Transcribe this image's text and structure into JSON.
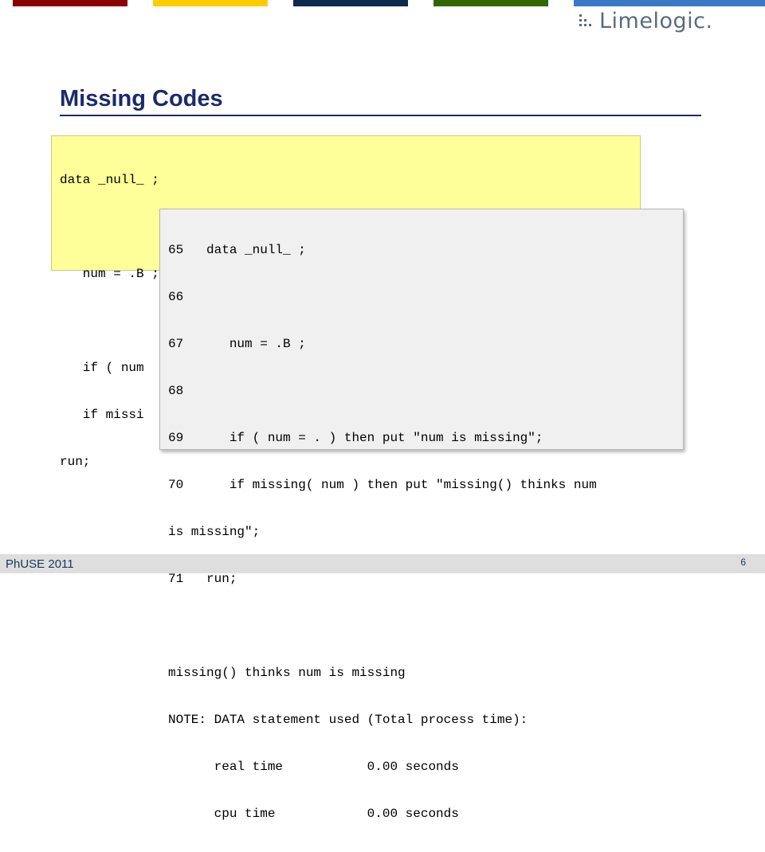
{
  "stripes": [
    {
      "name": "red",
      "color": "#8b0000"
    },
    {
      "name": "yellow",
      "color": "#ffcc00"
    },
    {
      "name": "navy",
      "color": "#0d2a4d"
    },
    {
      "name": "green",
      "color": "#336600"
    },
    {
      "name": "blue",
      "color": "#3a78c8"
    }
  ],
  "logo": {
    "text": "Limelogic.",
    "color": "#5a6b7c"
  },
  "title": "Missing Codes",
  "code_lines": [
    "data _null_ ;",
    "",
    "   num = .B ;",
    "",
    "   if ( num",
    "   if missi",
    "run;"
  ],
  "log_lines": [
    "65   data _null_ ;",
    "66",
    "67      num = .B ;",
    "68",
    "69      if ( num = . ) then put \"num is missing\";",
    "70      if missing( num ) then put \"missing() thinks num",
    "is missing\";",
    "71   run;",
    "",
    "missing() thinks num is missing",
    "NOTE: DATA statement used (Total process time):",
    "      real time           0.00 seconds",
    "      cpu time            0.00 seconds"
  ],
  "footer": {
    "left": "PhUSE 2011",
    "page_number": "6"
  }
}
